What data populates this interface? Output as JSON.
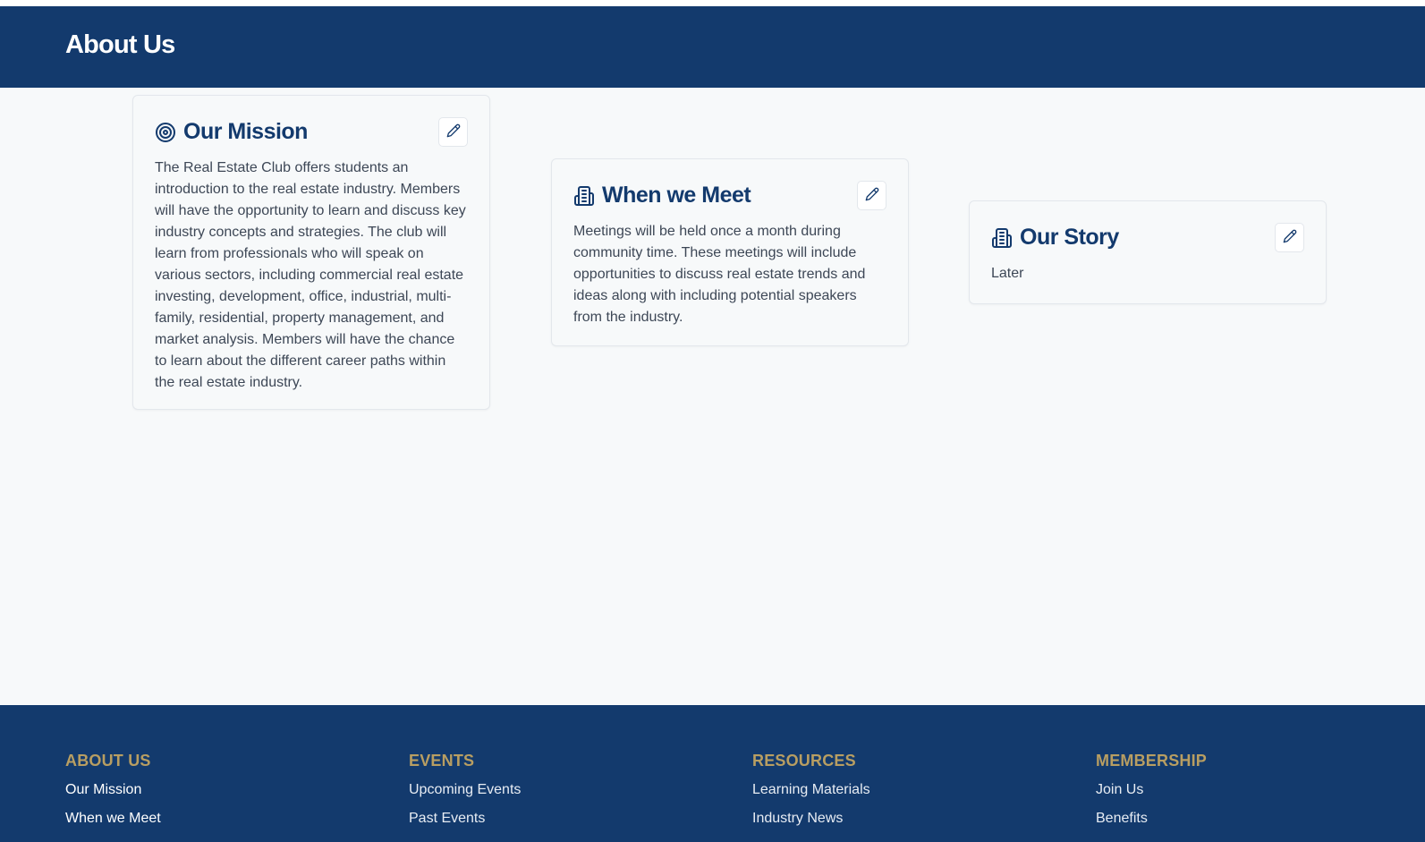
{
  "header": {
    "title": "About Us"
  },
  "cards": [
    {
      "title": "Our Mission",
      "icon": "target-icon",
      "text": "The Real Estate Club offers students an introduction to the real estate industry. Members will have the opportunity to learn and discuss key industry concepts and strategies. The club will learn from professionals who will speak on various sectors, including commercial real estate investing, development, office, industrial, multi-family, residential, property management, and market analysis. Members will have the chance to learn about the different career paths within the real estate industry."
    },
    {
      "title": "When we Meet",
      "icon": "building-icon",
      "text": "Meetings will be held once a month during community time. These meetings will include opportunities to discuss real estate trends and ideas along with including potential speakers from the industry."
    },
    {
      "title": "Our Story",
      "icon": "building-icon",
      "text": "Later"
    }
  ],
  "footer": {
    "columns": [
      {
        "heading": "ABOUT US",
        "links": [
          "Our Mission",
          "When we Meet"
        ]
      },
      {
        "heading": "EVENTS",
        "links": [
          "Upcoming Events",
          "Past Events"
        ]
      },
      {
        "heading": "RESOURCES",
        "links": [
          "Learning Materials",
          "Industry News"
        ]
      },
      {
        "heading": "MEMBERSHIP",
        "links": [
          "Join Us",
          "Benefits"
        ]
      }
    ]
  },
  "colors": {
    "primary": "#133a6d",
    "accent": "#b89e62",
    "background": "#f7f9fa",
    "text": "#3d4756"
  }
}
